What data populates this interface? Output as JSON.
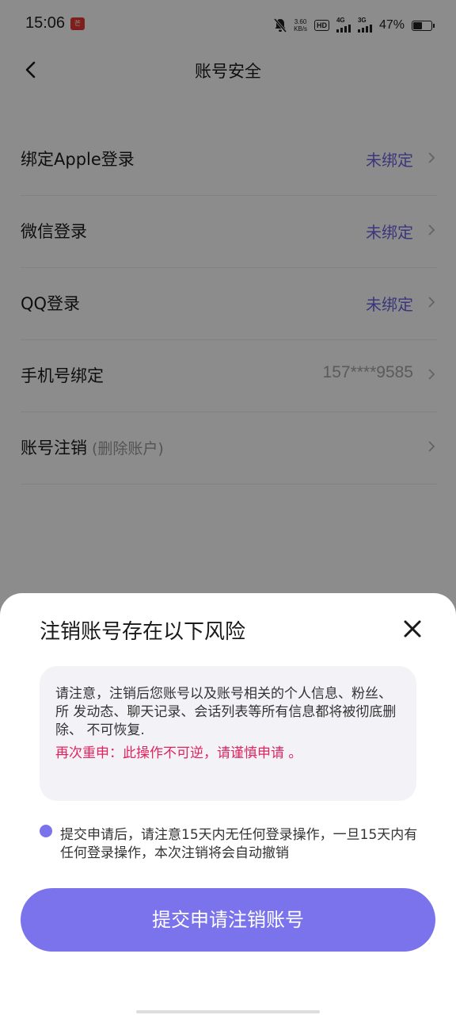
{
  "status_bar": {
    "time": "15:06",
    "app_icon_text": "芒",
    "net_speed_value": "3.60",
    "net_speed_unit": "KB/s",
    "hd_label": "HD",
    "sim1_label": "4G",
    "sim2_label": "3G",
    "battery_percent_text": "47%",
    "battery_level": 0.47
  },
  "header": {
    "title": "账号安全",
    "back_icon": "chevron-left-icon"
  },
  "settings": {
    "items": [
      {
        "label": "绑定Apple登录",
        "value": "未绑定"
      },
      {
        "label": "微信登录",
        "value": "未绑定"
      },
      {
        "label": "QQ登录",
        "value": "未绑定"
      },
      {
        "label": "手机号绑定",
        "value": "157****9585"
      },
      {
        "label": "账号注销",
        "sublabel": "(删除账户)"
      }
    ]
  },
  "dialog": {
    "title": "注销账号存在以下风险",
    "close_icon": "close-icon",
    "notice_text": "请注意，注销后您账号以及账号相关的个人信息、粉丝、所 发动态、聊天记录、会话列表等所有信息都将被彻底删除、 不可恢复.",
    "warning_text": "再次重申：此操作不可逆，请谨慎申请 。",
    "bullet_text": "提交申请后，请注意15天内无任何登录操作，一旦15天内有 任何登录操作，本次注销将会自动撤销",
    "submit_label": "提交申请注销账号"
  },
  "colors": {
    "accent": "#7b73ec",
    "link": "#6c63e0",
    "warning": "#e0245e"
  }
}
